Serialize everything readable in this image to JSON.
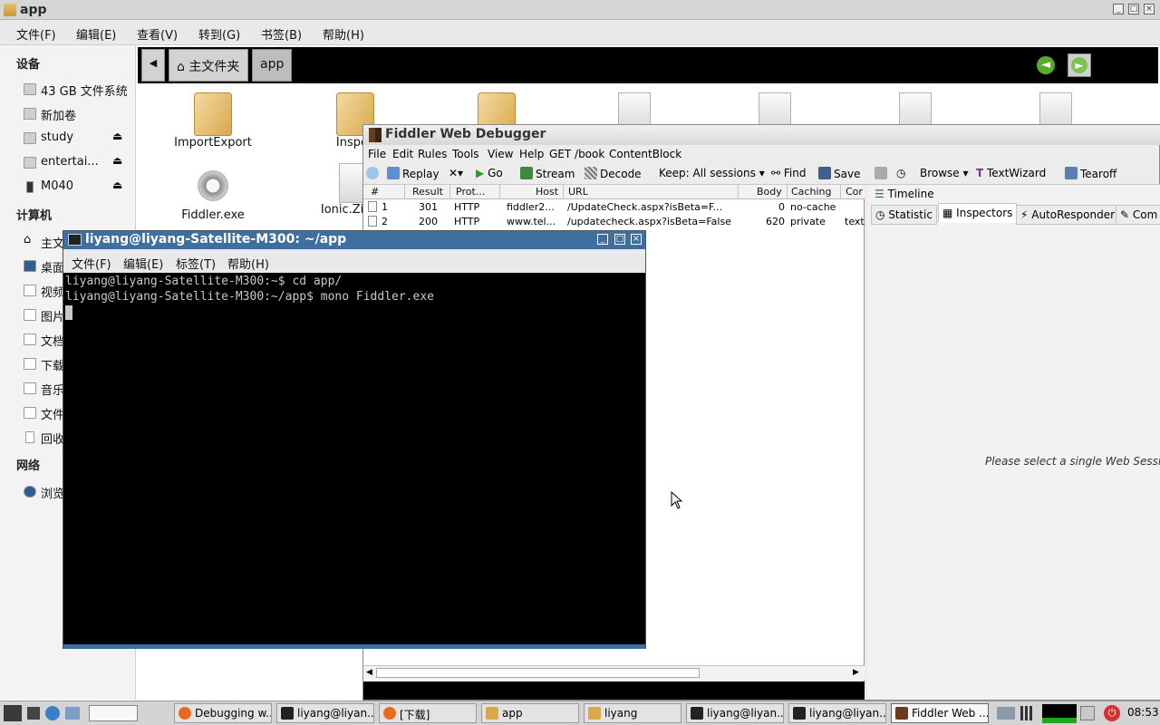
{
  "file_manager": {
    "title": "app",
    "menu": [
      "文件(F)",
      "编辑(E)",
      "查看(V)",
      "转到(G)",
      "书签(B)",
      "帮助(H)"
    ],
    "sidebar": {
      "devices_header": "设备",
      "devices": [
        "43 GB 文件系统",
        "新加卷",
        "study",
        "entertai...",
        "M040"
      ],
      "computer_header": "计算机",
      "computer": [
        "主文",
        "桌面",
        "视频",
        "图片",
        "文档",
        "下载",
        "音乐",
        "文件",
        "回收"
      ],
      "network_header": "网络",
      "network": [
        "浏览"
      ]
    },
    "path": {
      "home": "主文件夹",
      "current": "app"
    },
    "files": [
      {
        "name": "ImportExport",
        "type": "folder"
      },
      {
        "name": "Inspec",
        "type": "folder"
      },
      {
        "name": "",
        "type": "folder"
      },
      {
        "name": "",
        "type": "doc"
      },
      {
        "name": "",
        "type": "doc"
      },
      {
        "name": "",
        "type": "doc"
      },
      {
        "name": "",
        "type": "doc"
      },
      {
        "name": "Fiddler.exe",
        "type": "exe"
      },
      {
        "name": "Ionic.Zip.Re",
        "type": "doc"
      }
    ]
  },
  "fiddler": {
    "title": "Fiddler Web Debugger",
    "menu": [
      "File",
      "Edit",
      "Rules",
      "Tools",
      "View",
      "Help",
      "GET /book",
      "ContentBlock"
    ],
    "toolbar": [
      "Replay",
      "Go",
      "Stream",
      "Decode",
      "Keep: All sessions",
      "Find",
      "Save",
      "Browse",
      "TextWizard",
      "Tearoff"
    ],
    "columns": [
      "#",
      "Result",
      "Prot...",
      "Host",
      "URL",
      "Body",
      "Caching",
      "Cor"
    ],
    "sessions": [
      {
        "id": "1",
        "result": "301",
        "protocol": "HTTP",
        "host": "fiddler2...",
        "url": "/UpdateCheck.aspx?isBeta=F...",
        "body": "0",
        "caching": "no-cache",
        "content": ""
      },
      {
        "id": "2",
        "result": "200",
        "protocol": "HTTP",
        "host": "www.tel...",
        "url": "/updatecheck.aspx?isBeta=False",
        "body": "620",
        "caching": "private",
        "content": "text"
      }
    ],
    "right_tabs": {
      "timeline": "Timeline",
      "statistics": "Statistic",
      "inspectors": "Inspectors",
      "autoresponder": "AutoResponder",
      "composer": "Com"
    },
    "right_message": "Please select a single Web Session"
  },
  "terminal": {
    "title": "liyang@liyang-Satellite-M300: ~/app",
    "menu": [
      "文件(F)",
      "编辑(E)",
      "标签(T)",
      "帮助(H)"
    ],
    "lines": [
      "liyang@liyang-Satellite-M300:~$ cd app/",
      "liyang@liyang-Satellite-M300:~/app$ mono Fiddler.exe"
    ]
  },
  "taskbar": {
    "tasks": [
      "Debugging w...",
      "liyang@liyan...",
      "[下载]",
      "app",
      "liyang",
      "liyang@liyan...",
      "liyang@liyan...",
      "Fiddler Web ..."
    ],
    "clock": "08:53"
  }
}
